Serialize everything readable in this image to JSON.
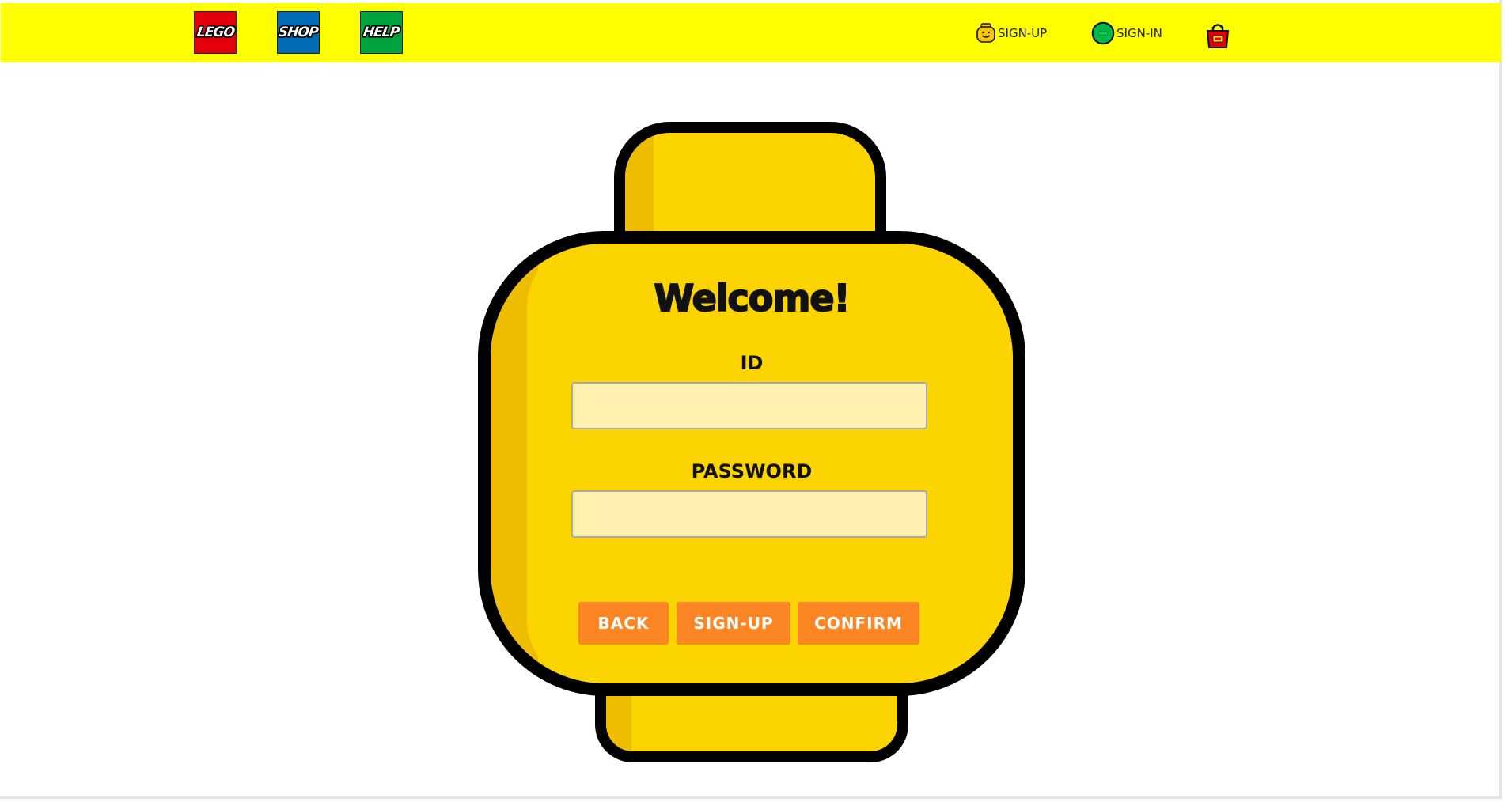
{
  "nav": {
    "tiles": [
      {
        "label": "LEGO",
        "color": "#e3000b"
      },
      {
        "label": "SHOP",
        "color": "#006cb7"
      },
      {
        "label": "HELP",
        "color": "#00a33d"
      }
    ],
    "signup_label": "SIGN-UP",
    "signin_label": "SIGN-IN",
    "bag_icon": "shopping-bag-icon",
    "bar_color": "#ffff00"
  },
  "login": {
    "title": "Welcome!",
    "id_label": "ID",
    "id_value": "",
    "password_label": "PASSWORD",
    "password_value": "",
    "buttons": {
      "back": "BACK",
      "signup": "SIGN-UP",
      "confirm": "CONFIRM"
    },
    "head_color": "#fbd402",
    "button_color": "#fd8624"
  }
}
